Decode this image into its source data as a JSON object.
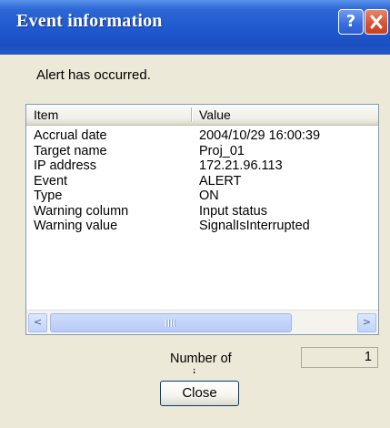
{
  "window": {
    "title": "Event information",
    "help_label": "?",
    "close_icon": "close-icon"
  },
  "message": "Alert has occurred.",
  "list": {
    "columns": [
      "Item",
      "Value"
    ],
    "rows": [
      {
        "item": "Accrual date",
        "value": "2004/10/29 16:00:39"
      },
      {
        "item": "Target name",
        "value": "Proj_01"
      },
      {
        "item": "IP address",
        "value": "172.21.96.113"
      },
      {
        "item": "Event",
        "value": "ALERT"
      },
      {
        "item": "Type",
        "value": "ON"
      },
      {
        "item": "Warning column",
        "value": "Input status"
      },
      {
        "item": "Warning value",
        "value": "SignalIsInterrupted"
      }
    ],
    "scroll_left_label": "<",
    "scroll_right_label": ">"
  },
  "count": {
    "label": "Number of",
    "label_cont": "i",
    "value": "1"
  },
  "buttons": {
    "close_label": "Close"
  },
  "colors": {
    "titlebar": "#1f58cf",
    "dialog_bg": "#ece9d8",
    "close_button_red": "#d85434"
  }
}
